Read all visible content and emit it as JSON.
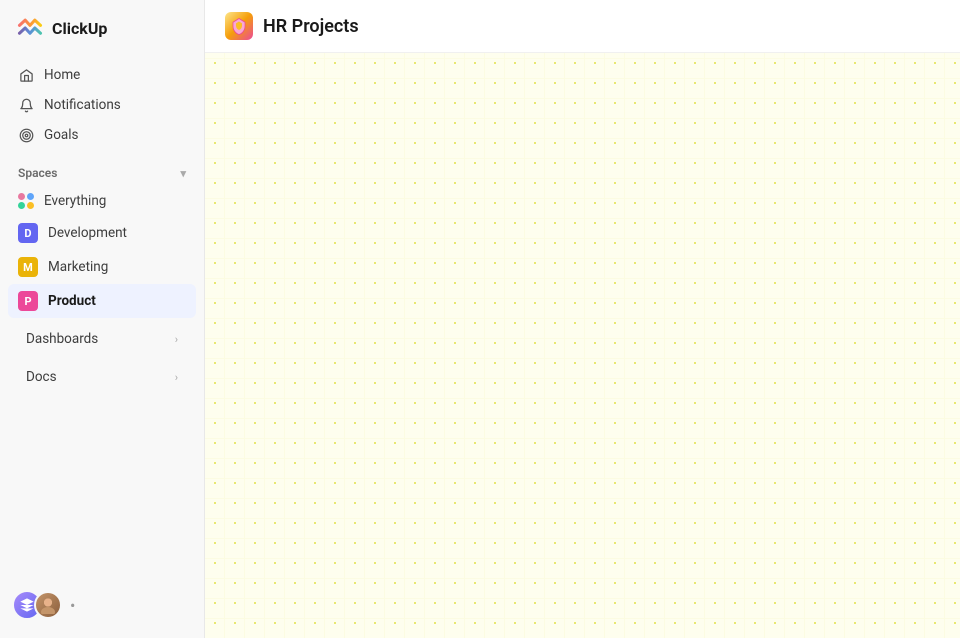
{
  "app": {
    "name": "ClickUp"
  },
  "sidebar": {
    "nav": [
      {
        "id": "home",
        "label": "Home",
        "icon": "home"
      },
      {
        "id": "notifications",
        "label": "Notifications",
        "icon": "bell"
      },
      {
        "id": "goals",
        "label": "Goals",
        "icon": "target"
      }
    ],
    "spaces_label": "Spaces",
    "spaces": [
      {
        "id": "everything",
        "label": "Everything",
        "type": "dots"
      },
      {
        "id": "development",
        "label": "Development",
        "type": "avatar",
        "color": "#6366f1",
        "letter": "D"
      },
      {
        "id": "marketing",
        "label": "Marketing",
        "type": "avatar",
        "color": "#eab308",
        "letter": "M"
      },
      {
        "id": "product",
        "label": "Product",
        "type": "avatar",
        "color": "#ec4899",
        "letter": "P",
        "active": true
      }
    ],
    "expandable": [
      {
        "id": "dashboards",
        "label": "Dashboards"
      },
      {
        "id": "docs",
        "label": "Docs"
      }
    ]
  },
  "main": {
    "page_title": "HR Projects",
    "page_icon": "📦"
  }
}
